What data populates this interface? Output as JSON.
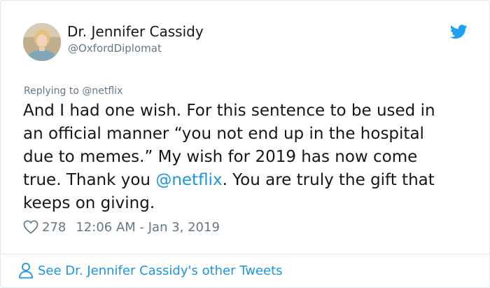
{
  "author": {
    "display_name": "Dr. Jennifer Cassidy",
    "handle": "@OxfordDiplomat"
  },
  "tweet": {
    "replying_prefix": "Replying to ",
    "replying_to": "@netflix",
    "lines": [
      "And I had one wish. For this sentence to be used in",
      "an official manner “you not end up in the hospital",
      "due to memes.” My wish for 2019 has now come"
    ],
    "line4_before": "true. Thank you ",
    "line4_mention": "@netflix",
    "line4_after": ". You are truly the gift that",
    "line5": "keeps on giving.",
    "likes": "278",
    "timestamp": "12:06 AM - Jan 3, 2019"
  },
  "footer": {
    "other_tweets_label": "See Dr. Jennifer Cassidy's other Tweets"
  },
  "colors": {
    "link": "#1b95e0",
    "muted": "#657786",
    "text": "#14171a",
    "twitter_blue": "#1da1f2"
  },
  "icons": {
    "brand": "twitter-bird-icon",
    "like": "heart-icon",
    "profile": "person-icon"
  }
}
